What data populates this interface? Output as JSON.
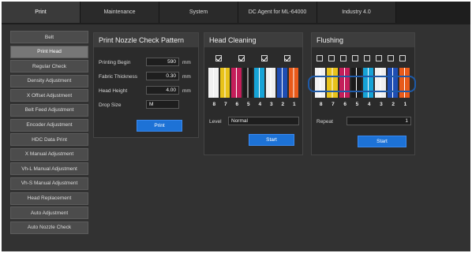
{
  "tabs": [
    "Print",
    "Maintenance",
    "System",
    "DC Agent for ML-64000",
    "Industry 4.0"
  ],
  "active_tab": 0,
  "sidebar": [
    "Belt",
    "Print Head",
    "Regular Check",
    "Density Adjustment",
    "X Offset Adjustment",
    "Belt Feed Adjustment",
    "Encoder Adjustment",
    "HDC Data Print",
    "X Manual Adjustment",
    "Vh-L Manual Adjustment",
    "Vh-S Manual Adjustment",
    "Head Replacement",
    "Auto Adjustment",
    "Auto Nozzle Check"
  ],
  "active_sidebar": 1,
  "nozzle_check": {
    "title": "Print Nozzle Check Pattern",
    "printing_begin_label": "Printing Begin",
    "printing_begin_value": "590",
    "printing_begin_unit": "mm",
    "fabric_thickness_label": "Fabric Thickness",
    "fabric_thickness_value": "0.30",
    "fabric_thickness_unit": "mm",
    "head_height_label": "Head Height",
    "head_height_value": "4.00",
    "head_height_unit": "mm",
    "drop_size_label": "Drop Size",
    "drop_size_value": "M",
    "print_button": "Print"
  },
  "head_cleaning": {
    "title": "Head Cleaning",
    "checkboxes": [
      true,
      true,
      true,
      true
    ],
    "head_numbers": [
      "8",
      "7",
      "6",
      "5",
      "4",
      "3",
      "2",
      "1"
    ],
    "level_label": "Level",
    "level_value": "Normal",
    "start_button": "Start"
  },
  "flushing": {
    "title": "Flushing",
    "checkboxes": [
      false,
      false,
      false,
      false,
      false,
      false,
      false,
      false
    ],
    "head_numbers": [
      "8",
      "7",
      "6",
      "5",
      "4",
      "3",
      "2",
      "1"
    ],
    "repeat_label": "Repeat",
    "repeat_value": "1",
    "start_button": "Start"
  },
  "ink_colors": [
    "#f2f2f2",
    "#e8c21a",
    "#c41e5a",
    "#1a1a1a",
    "#16a3d6",
    "#f0f0f0",
    "#1e4db3",
    "#e85a1a"
  ]
}
